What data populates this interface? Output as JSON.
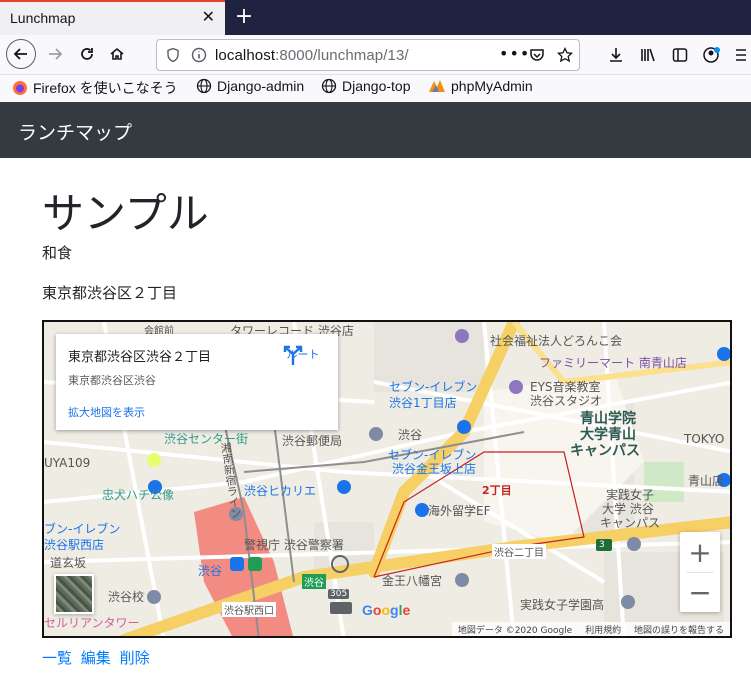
{
  "browser": {
    "tab_title": "Lunchmap",
    "url_host": "localhost",
    "url_rest": ":8000/lunchmap/13/",
    "bookmarks": [
      {
        "label": "Firefox を使いこなそう",
        "icon": "firefox-icon"
      },
      {
        "label": "Django-admin",
        "icon": "globe-icon"
      },
      {
        "label": "Django-top",
        "icon": "globe-icon"
      },
      {
        "label": "phpMyAdmin",
        "icon": "phpmyadmin-icon"
      }
    ]
  },
  "app": {
    "brand": "ランチマップ"
  },
  "shop": {
    "name": "サンプル",
    "genre": "和食",
    "address": "東京都渋谷区２丁目"
  },
  "map": {
    "card": {
      "title": "東京都渋谷区渋谷２丁目",
      "subtitle": "東京都渋谷区渋谷",
      "enlarge_link": "拡大地図を表示",
      "route_label": "ルート"
    },
    "labels": {
      "l1": "社会福祉法人どろんこ会",
      "l2": "ファミリーマート 南青山店",
      "l3": "セブン-イレブン",
      "l3b": "渋谷1丁目店",
      "l4": "EYS音楽教室",
      "l4b": "渋谷スタジオ",
      "l5": "青山学院",
      "l5b": "大学青山",
      "l5c": "キャンパス",
      "l6": "TOKYO",
      "l7": "渋谷センター街",
      "l8": "渋谷郵便局",
      "l9": "渋谷",
      "l10": "セブン-イレブン",
      "l10b": "渋谷金王坂上店",
      "l11": "UYA109",
      "l12": "忠犬ハチ公像",
      "l13": "渋谷ヒカリエ",
      "l14": "2丁目",
      "l15": "実践女子",
      "l15b": "大学 渋谷",
      "l15c": "キャンパス",
      "l16": "ブン-イレブン",
      "l16b": "渋谷駅西店",
      "l17": "海外留学EF",
      "l18": "警視庁 渋谷警察署",
      "l19": "渋谷二丁目",
      "l20": "道玄坂",
      "l21": "渋谷",
      "l22": "金王八幡宮",
      "l23": "渋谷校",
      "l24": "渋谷駅西口",
      "l25": "実践女子学園高",
      "l26": "セルリアンタワー",
      "l27": "湘南新宿ライン",
      "l28": "青山店",
      "l29": "タワーレコード 渋谷店",
      "l30": "会館前",
      "l31": "305",
      "l32": "3",
      "l33": "渋谷"
    },
    "google_logo": "Google",
    "attribution": {
      "data": "地図データ ©2020 Google",
      "terms": "利用規約",
      "report": "地図の誤りを報告する"
    },
    "zoom_in": "+",
    "zoom_out": "−"
  },
  "actions": {
    "list": "一覧",
    "edit": "編集",
    "delete": "削除"
  }
}
